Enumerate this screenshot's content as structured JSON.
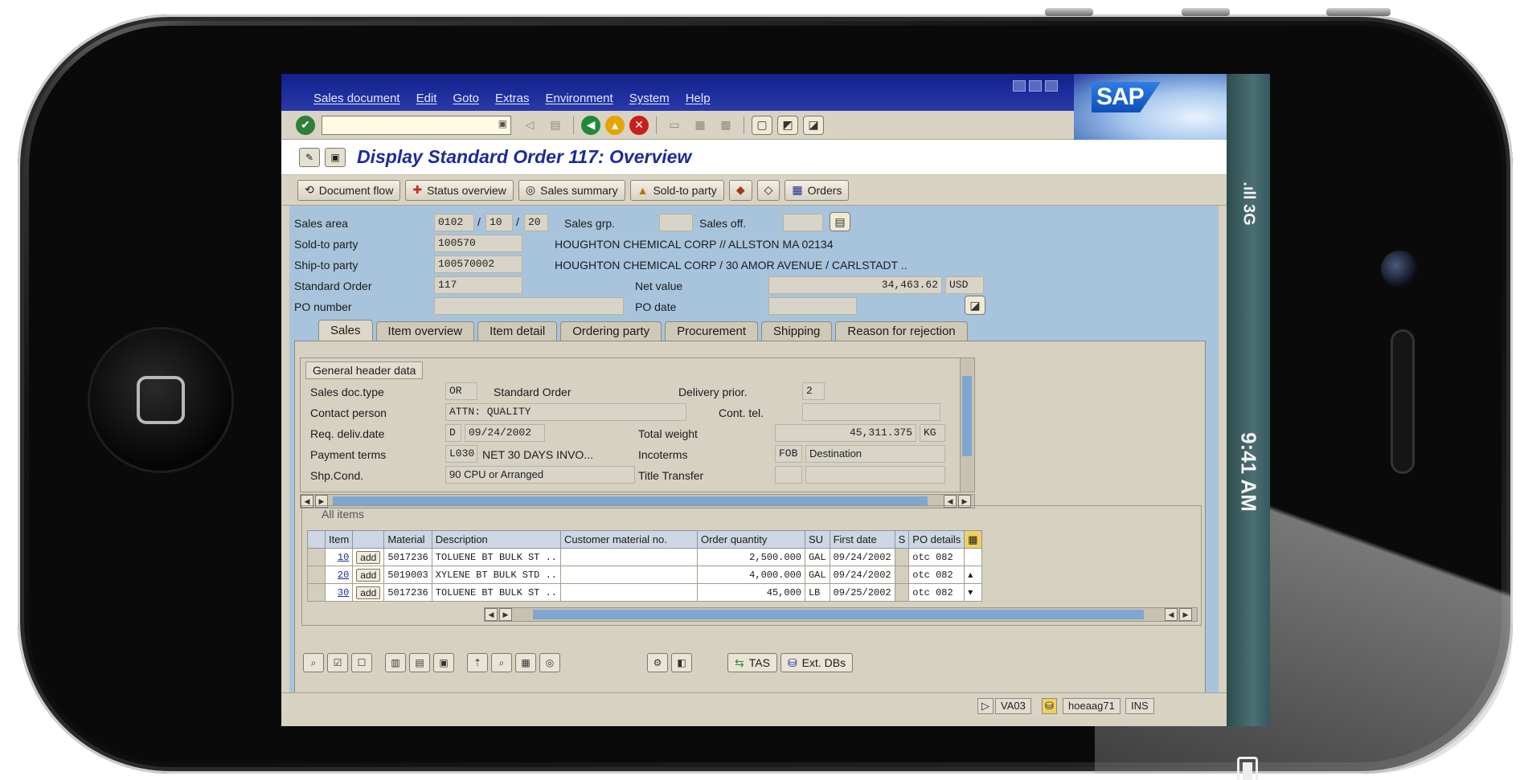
{
  "phone": {
    "status_signal": ".ıll 3G",
    "status_time": "9:41 AM"
  },
  "sap": {
    "logo": "SAP",
    "menu": [
      "Sales document",
      "Edit",
      "Goto",
      "Extras",
      "Environment",
      "System",
      "Help"
    ],
    "title": "Display Standard Order 117: Overview",
    "app_buttons": [
      {
        "label": "Document flow",
        "icon": "document-flow-icon"
      },
      {
        "label": "Status overview",
        "icon": "status-overview-icon"
      },
      {
        "label": "Sales summary",
        "icon": "sales-summary-icon"
      },
      {
        "label": "Sold-to party",
        "icon": "sold-to-party-icon"
      },
      {
        "label": "Orders",
        "icon": "orders-icon"
      }
    ],
    "header": {
      "sales_area_label": "Sales area",
      "sales_area": [
        "0102",
        "10",
        "20"
      ],
      "sales_grp_label": "Sales grp.",
      "sales_off_label": "Sales off.",
      "sold_to_label": "Sold-to party",
      "sold_to_value": "100570",
      "sold_to_text": "HOUGHTON CHEMICAL CORP // ALLSTON MA 02134",
      "ship_to_label": "Ship-to party",
      "ship_to_value": "100570002",
      "ship_to_text": "HOUGHTON CHEMICAL CORP / 30 AMOR AVENUE / CARLSTADT ..",
      "std_order_label": "Standard Order",
      "std_order_value": "117",
      "net_value_label": "Net value",
      "net_value": "34,463.62",
      "currency": "USD",
      "po_number_label": "PO number",
      "po_date_label": "PO date"
    },
    "tabs": [
      "Sales",
      "Item overview",
      "Item detail",
      "Ordering party",
      "Procurement",
      "Shipping",
      "Reason for rejection"
    ],
    "general": {
      "title": "General header data",
      "doc_type_label": "Sales doc.type",
      "doc_type": "OR",
      "doc_type_text": "Standard Order",
      "delivery_prior_label": "Delivery prior.",
      "delivery_prior": "2",
      "contact_label": "Contact person",
      "contact": "ATTN: QUALITY",
      "cont_tel_label": "Cont. tel.",
      "req_date_label": "Req. deliv.date",
      "req_date_type": "D",
      "req_date": "09/24/2002",
      "total_weight_label": "Total weight",
      "total_weight": "45,311.375",
      "weight_unit": "KG",
      "payment_label": "Payment terms",
      "payment": "L030",
      "payment_text": "NET 30 DAYS INVO...",
      "incoterms_label": "Incoterms",
      "incoterms": "FOB",
      "incoterms_text": "Destination",
      "shp_cond_label": "Shp.Cond.",
      "shp_cond": "90 CPU or Arranged",
      "title_transfer_label": "Title Transfer"
    },
    "items": {
      "title": "All items",
      "columns": [
        "Item",
        "",
        "Material",
        "Description",
        "Customer material no.",
        "Order quantity",
        "SU",
        "First date",
        "S",
        "PO details"
      ],
      "rows": [
        {
          "item": "10",
          "btn": "add",
          "material": "5017236",
          "description": "TOLUENE BT BULK ST ..",
          "cust_mat": "",
          "qty": "2,500.000",
          "su": "GAL",
          "date": "09/24/2002",
          "s": "",
          "po": "otc 082"
        },
        {
          "item": "20",
          "btn": "add",
          "material": "5019003",
          "description": "XYLENE BT BULK STD ..",
          "cust_mat": "",
          "qty": "4,000.000",
          "su": "GAL",
          "date": "09/24/2002",
          "s": "",
          "po": "otc 082"
        },
        {
          "item": "30",
          "btn": "add",
          "material": "5017236",
          "description": "TOLUENE BT BULK ST ..",
          "cust_mat": "",
          "qty": "45,000",
          "su": "LB",
          "date": "09/25/2002",
          "s": "",
          "po": "otc 082"
        }
      ]
    },
    "bottom_buttons": {
      "tas": "TAS",
      "ext_dbs": "Ext. DBs"
    },
    "status": {
      "transaction": "VA03",
      "server": "hoeaag71",
      "mode": "INS"
    }
  }
}
